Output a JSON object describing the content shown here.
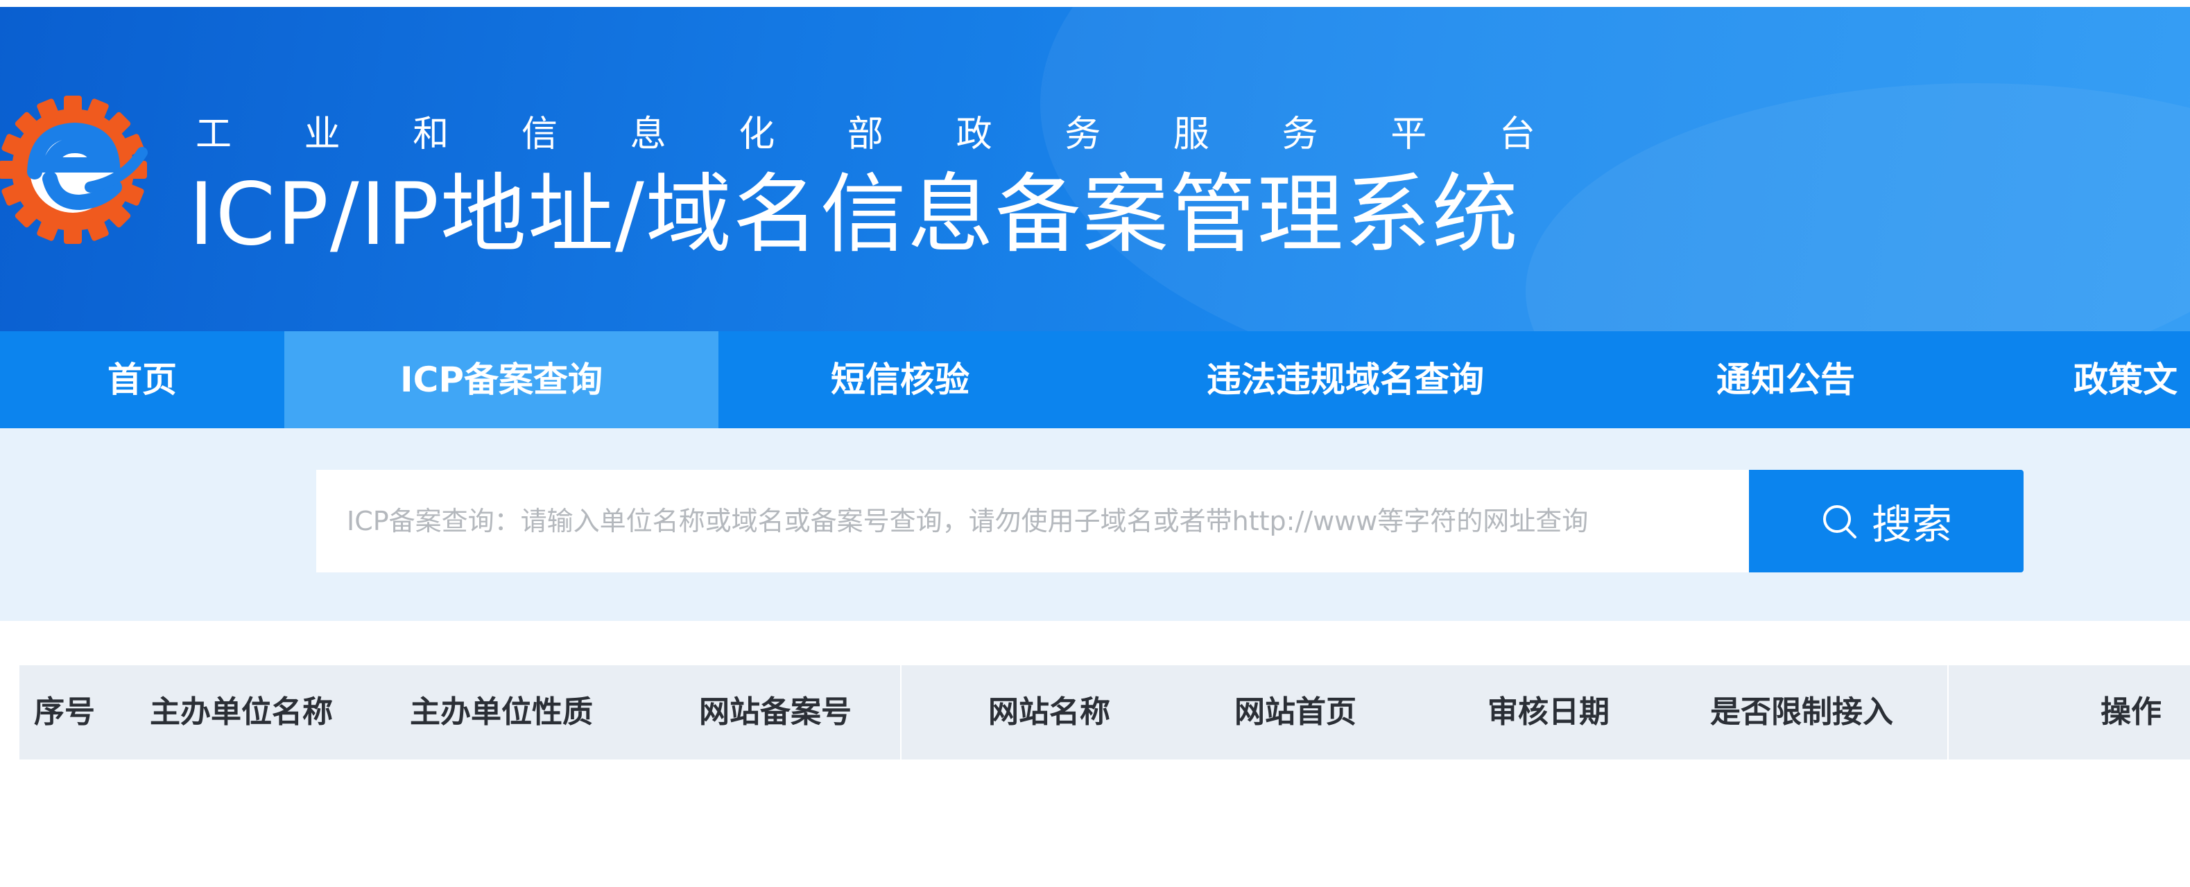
{
  "header": {
    "subtitle_chars": [
      "工",
      "业",
      "和",
      "信",
      "息",
      "化",
      "部",
      "政",
      "务",
      "服",
      "务",
      "平",
      "台"
    ],
    "title": "ICP/IP地址/域名信息备案管理系统",
    "logo_icon": "gear-e-logo-icon",
    "colors": {
      "banner": "#1478e3",
      "logo_gear": "#f05a1e",
      "logo_e": "#1b7fe8"
    }
  },
  "nav": {
    "items": [
      {
        "label": "首页",
        "active": false
      },
      {
        "label": "ICP备案查询",
        "active": true
      },
      {
        "label": "短信核验",
        "active": false
      },
      {
        "label": "违法违规域名查询",
        "active": false
      },
      {
        "label": "通知公告",
        "active": false
      },
      {
        "label": "政策文",
        "active": false
      }
    ],
    "colors": {
      "bar": "#0c84ee",
      "active": "#40a6f6"
    }
  },
  "search": {
    "placeholder": "ICP备案查询：请输入单位名称或域名或备案号查询，请勿使用子域名或者带http://www等字符的网址查询",
    "value": "",
    "button_label": "搜索",
    "button_icon": "search-icon"
  },
  "table": {
    "columns": [
      "序号",
      "主办单位名称",
      "主办单位性质",
      "网站备案号",
      "网站名称",
      "网站首页",
      "审核日期",
      "是否限制接入",
      "操作"
    ],
    "rows": []
  }
}
